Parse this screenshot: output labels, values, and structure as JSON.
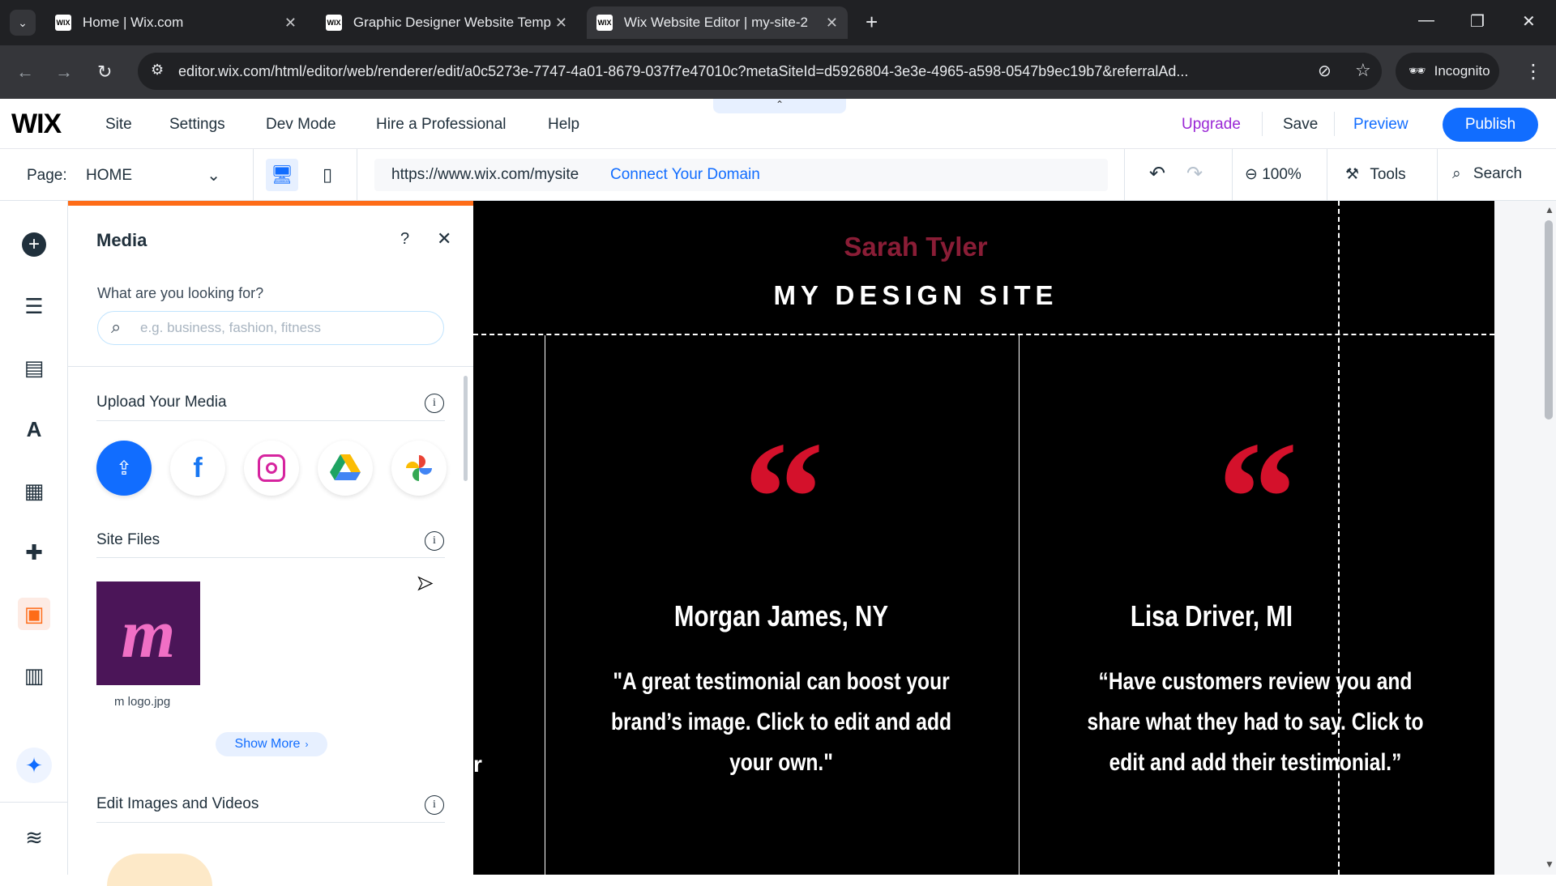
{
  "browser": {
    "tabs": [
      {
        "label": "Home | Wix.com",
        "favicon": "WIX"
      },
      {
        "label": "Graphic Designer Website Temp",
        "favicon": "WIX"
      },
      {
        "label": "Wix Website Editor | my-site-2",
        "favicon": "WIX"
      }
    ],
    "url": "editor.wix.com/html/editor/web/renderer/edit/a0c5273e-7747-4a01-8679-037f7e47010c?metaSiteId=d5926804-3e3e-4965-a598-0547b9ec19b7&referralAd...",
    "incognito_label": "Incognito"
  },
  "editor": {
    "logo": "WIX",
    "menu": [
      "Site",
      "Settings",
      "Dev Mode",
      "Hire a Professional",
      "Help"
    ],
    "upgrade": "Upgrade",
    "save": "Save",
    "preview": "Preview",
    "publish": "Publish",
    "page_label": "Page:",
    "page_value": "HOME",
    "site_url": "https://www.wix.com/mysite",
    "connect_domain": "Connect Your Domain",
    "zoom": "100%",
    "tools": "Tools",
    "search": "Search",
    "accent": "#116dff"
  },
  "media_panel": {
    "title": "Media",
    "search_heading": "What are you looking for?",
    "search_placeholder": "e.g. business, fashion, fitness",
    "upload_heading": "Upload Your Media",
    "site_files_heading": "Site Files",
    "file_name": "m logo.jpg",
    "show_more": "Show More",
    "edit_heading": "Edit Images and Videos",
    "accent": "#fe6c18"
  },
  "canvas": {
    "site_owner": "Sarah Tyler",
    "site_title": "MY DESIGN SITE",
    "testimonials": [
      {
        "name": "Morgan James, NY",
        "text": "\"A great testimonial can boost your brand’s image. Click to edit and add your own.\""
      },
      {
        "name": "Lisa Driver, MI",
        "text": "“Have customers review you and share what they had to say. Click to edit and add their testimonial.”"
      }
    ],
    "edge_letter": "r",
    "quote_color": "#d4112b"
  }
}
